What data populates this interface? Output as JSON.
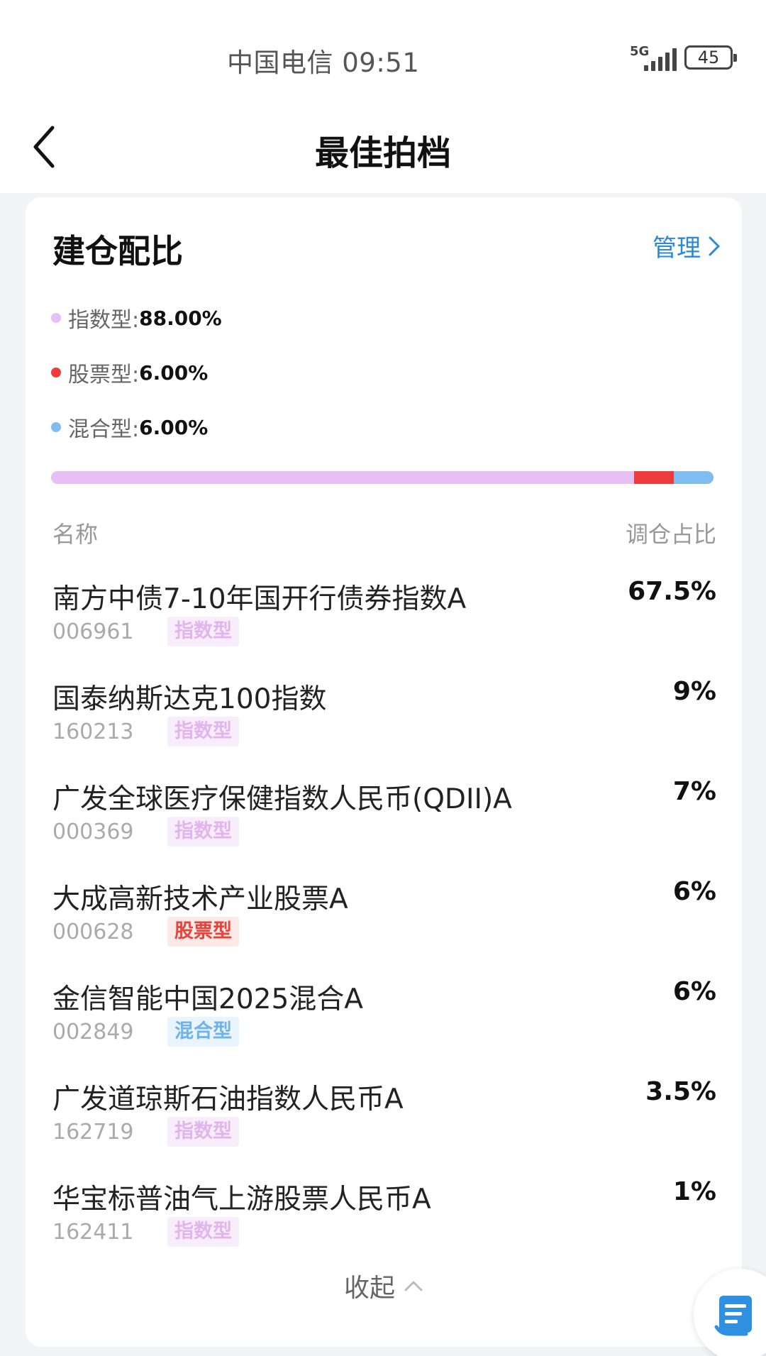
{
  "statusbar": {
    "carrier_time": "中国电信 09:51",
    "network": "5G",
    "battery": "45"
  },
  "nav": {
    "title": "最佳拍档",
    "back_icon": "chevron-left-icon"
  },
  "card": {
    "title": "建仓配比",
    "manage_label": "管理",
    "legend": [
      {
        "label": "指数型:",
        "value": "88.00%",
        "color": "#e6bff3",
        "share": 0.88
      },
      {
        "label": "股票型:",
        "value": "6.00%",
        "color": "#ee3b3b",
        "share": 0.06
      },
      {
        "label": "混合型:",
        "value": "6.00%",
        "color": "#7fbdf0",
        "share": 0.06
      }
    ],
    "columns": {
      "name": "名称",
      "ratio": "调仓占比"
    },
    "funds": [
      {
        "name": "南方中债7-10年国开行债券指数A",
        "code": "006961",
        "type": "指数型",
        "type_key": "index",
        "pct": "67.5%"
      },
      {
        "name": "国泰纳斯达克100指数",
        "code": "160213",
        "type": "指数型",
        "type_key": "index",
        "pct": "9%"
      },
      {
        "name": "广发全球医疗保健指数人民币(QDII)A",
        "code": "000369",
        "type": "指数型",
        "type_key": "index",
        "pct": "7%"
      },
      {
        "name": "大成高新技术产业股票A",
        "code": "000628",
        "type": "股票型",
        "type_key": "stock",
        "pct": "6%"
      },
      {
        "name": "金信智能中国2025混合A",
        "code": "002849",
        "type": "混合型",
        "type_key": "mixed",
        "pct": "6%"
      },
      {
        "name": "广发道琼斯石油指数人民币A",
        "code": "162719",
        "type": "指数型",
        "type_key": "index",
        "pct": "3.5%"
      },
      {
        "name": "华宝标普油气上游股票人民币A",
        "code": "162411",
        "type": "指数型",
        "type_key": "index",
        "pct": "1%"
      }
    ],
    "collapse_label": "收起"
  },
  "float_button": {
    "icon": "document-list-icon"
  }
}
